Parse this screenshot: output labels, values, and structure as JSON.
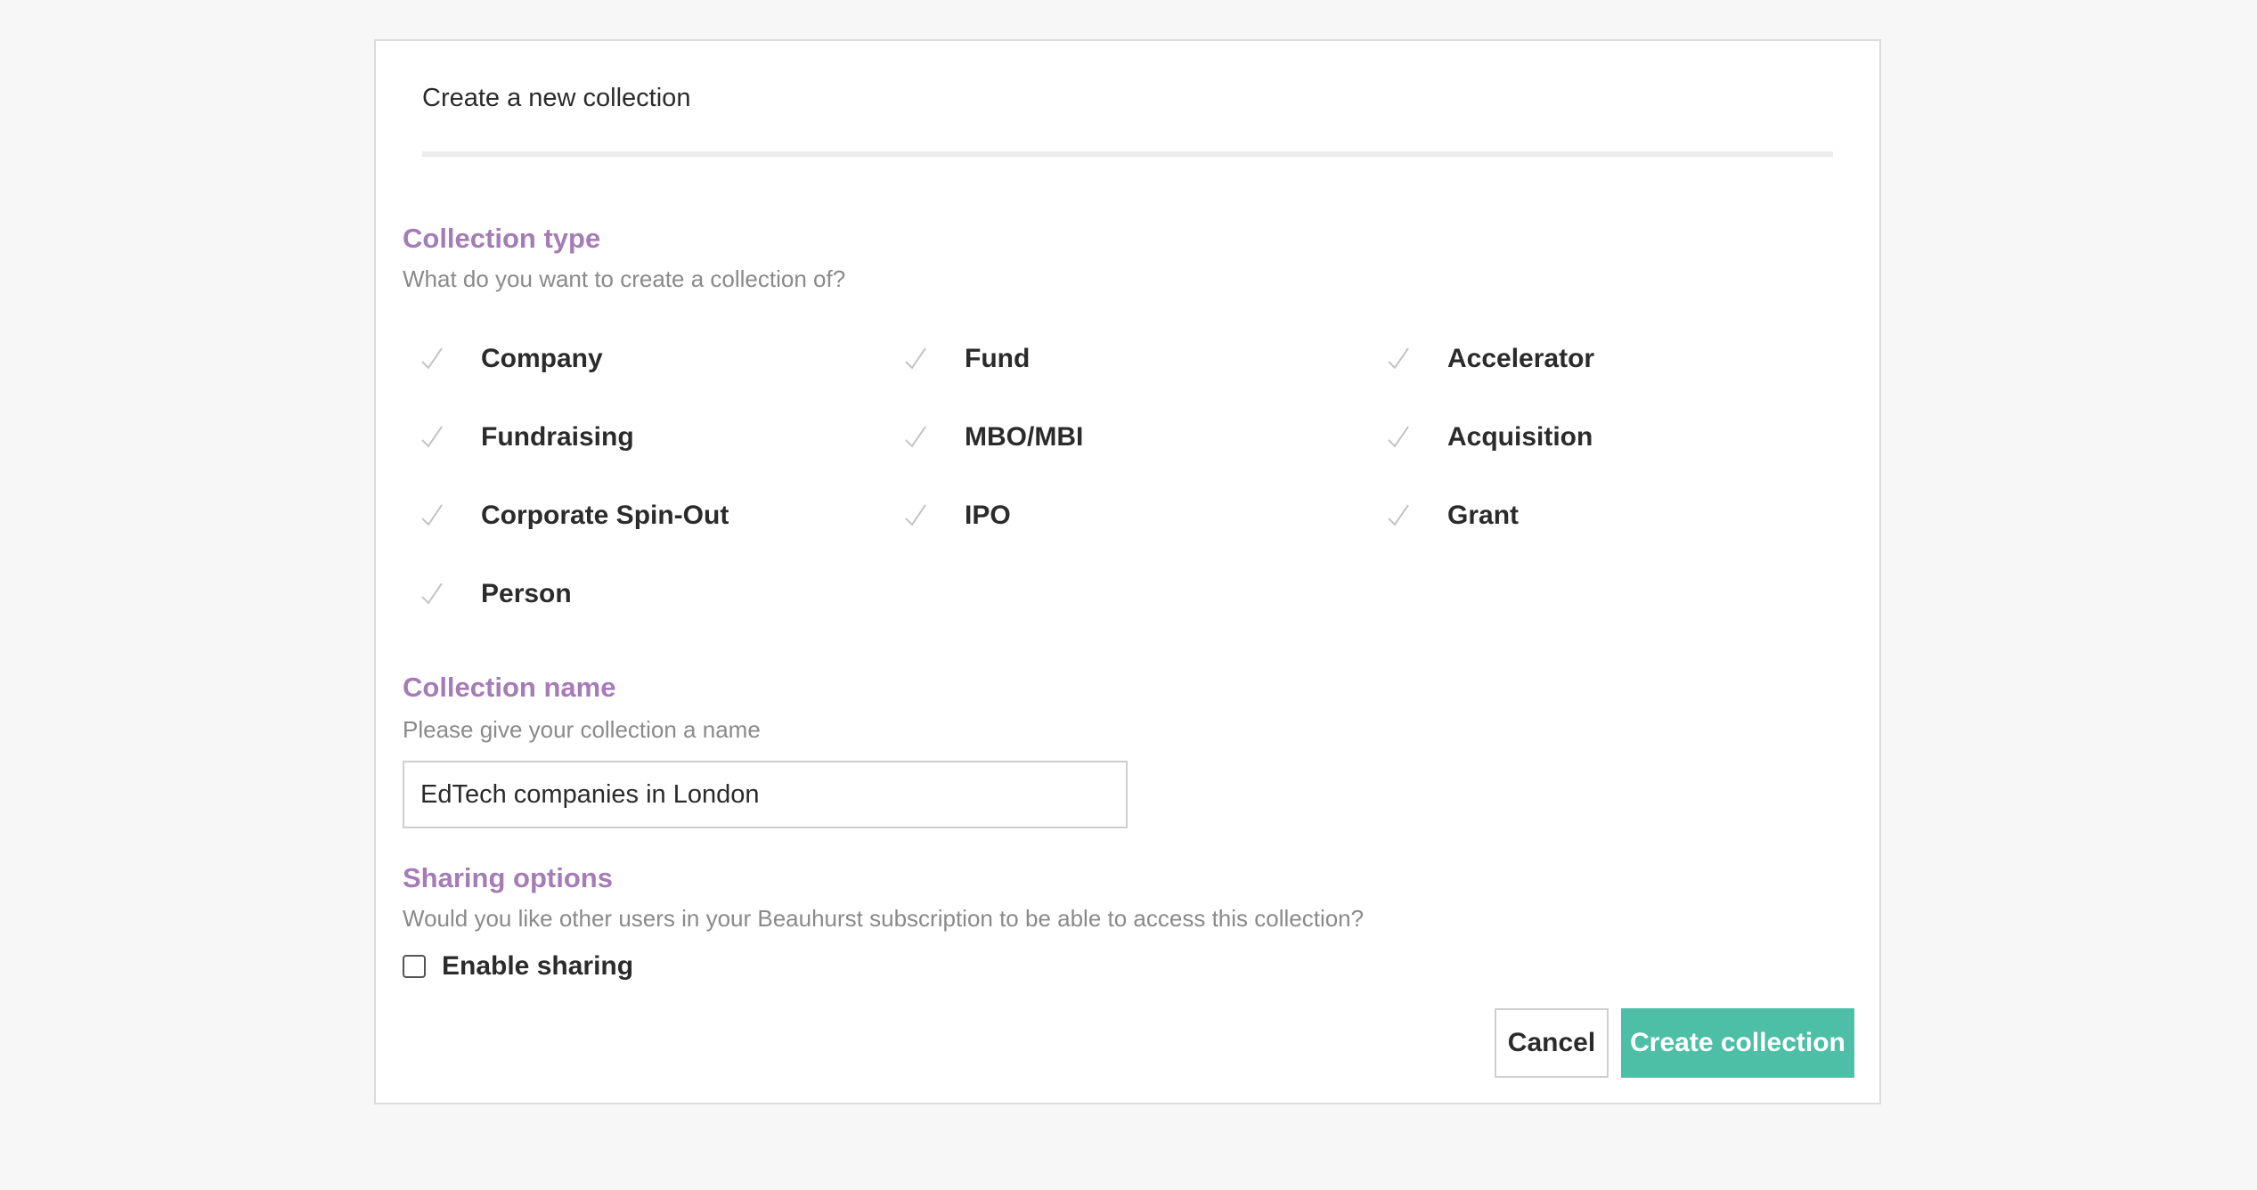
{
  "modal": {
    "title": "Create a new collection"
  },
  "collection_type": {
    "heading": "Collection type",
    "description": "What do you want to create a collection of?",
    "options": [
      {
        "label": "Company",
        "icon": "check-icon"
      },
      {
        "label": "Fund",
        "icon": "check-icon"
      },
      {
        "label": "Accelerator",
        "icon": "check-icon"
      },
      {
        "label": "Fundraising",
        "icon": "check-icon"
      },
      {
        "label": "MBO/MBI",
        "icon": "check-icon"
      },
      {
        "label": "Acquisition",
        "icon": "check-icon"
      },
      {
        "label": "Corporate Spin-Out",
        "icon": "check-icon"
      },
      {
        "label": "IPO",
        "icon": "check-icon"
      },
      {
        "label": "Grant",
        "icon": "check-icon"
      },
      {
        "label": "Person",
        "icon": "check-icon"
      }
    ]
  },
  "collection_name": {
    "heading": "Collection name",
    "description": "Please give your collection a name",
    "value": "EdTech companies in London"
  },
  "sharing": {
    "heading": "Sharing options",
    "description": "Would you like other users in your Beauhurst subscription to be able to access this collection?",
    "checkbox_label": "Enable sharing",
    "checked": false
  },
  "actions": {
    "cancel_label": "Cancel",
    "create_label": "Create collection"
  },
  "colors": {
    "accent_purple": "#a57cb6",
    "primary_teal": "#4cbfa6",
    "check_gray": "#c4c4c4"
  }
}
